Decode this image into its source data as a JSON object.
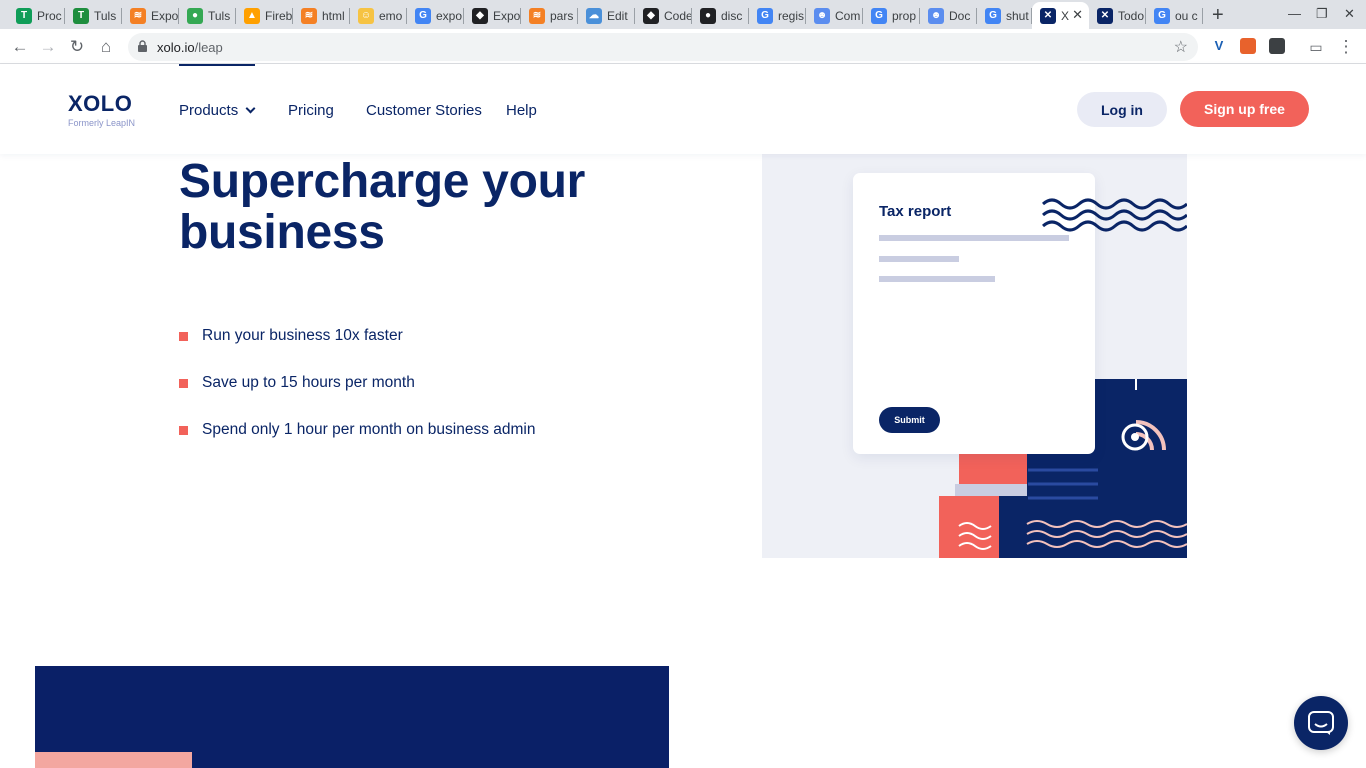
{
  "browser": {
    "tabs": [
      {
        "label": "Proc",
        "icon": "sheets-icon",
        "color": "#0f9d58",
        "glyph": "T"
      },
      {
        "label": "Tuls",
        "icon": "tuls-icon",
        "color": "#1e8e3e",
        "glyph": "T"
      },
      {
        "label": "Expo",
        "icon": "stackoverflow-icon",
        "color": "#f48024",
        "glyph": "≋"
      },
      {
        "label": "Tuls",
        "icon": "leaf-icon",
        "color": "#34a853",
        "glyph": "●"
      },
      {
        "label": "Fireb",
        "icon": "firebase-icon",
        "color": "#ffa000",
        "glyph": "▲"
      },
      {
        "label": "html",
        "icon": "stackoverflow-icon",
        "color": "#f48024",
        "glyph": "≋"
      },
      {
        "label": "emo",
        "icon": "emoji-icon",
        "color": "#f6c343",
        "glyph": "☺"
      },
      {
        "label": "expo",
        "icon": "google-icon",
        "color": "#4285f4",
        "glyph": "G"
      },
      {
        "label": "Expo",
        "icon": "expo-icon",
        "color": "#202124",
        "glyph": "◆"
      },
      {
        "label": "pars",
        "icon": "stackoverflow-icon",
        "color": "#f48024",
        "glyph": "≋"
      },
      {
        "label": "Edit",
        "icon": "cloud-icon",
        "color": "#4a90d9",
        "glyph": "☁"
      },
      {
        "label": "Code",
        "icon": "codepen-icon",
        "color": "#202124",
        "glyph": "◆"
      },
      {
        "label": "disc",
        "icon": "github-icon",
        "color": "#202124",
        "glyph": "●"
      },
      {
        "label": "regis",
        "icon": "google-icon",
        "color": "#4285f4",
        "glyph": "G"
      },
      {
        "label": "Com",
        "icon": "people-icon",
        "color": "#5b8def",
        "glyph": "☻"
      },
      {
        "label": "prop",
        "icon": "google-icon",
        "color": "#4285f4",
        "glyph": "G"
      },
      {
        "label": "Doc",
        "icon": "people-icon",
        "color": "#5b8def",
        "glyph": "☻"
      },
      {
        "label": "shut",
        "icon": "google-icon",
        "color": "#4285f4",
        "glyph": "G"
      },
      {
        "label": "X",
        "icon": "xolo-icon",
        "color": "#0a2566",
        "glyph": "✕"
      },
      {
        "label": "Todo",
        "icon": "xolo-icon",
        "color": "#0a2566",
        "glyph": "✕"
      },
      {
        "label": "ou c",
        "icon": "google-icon",
        "color": "#4285f4",
        "glyph": "G"
      }
    ],
    "url_host": "xolo.io",
    "url_path": "/leap"
  },
  "header": {
    "logo_text": "XOLO",
    "logo_sub": "Formerly LeapIN",
    "nav": {
      "products": "Products",
      "pricing": "Pricing",
      "stories": "Customer Stories",
      "help": "Help"
    },
    "login": "Log in",
    "signup": "Sign up free"
  },
  "hero": {
    "title": "Supercharge your business",
    "bullets": [
      "Run your business 10x faster",
      "Save up to 15 hours per month",
      "Spend only 1 hour per month on business admin"
    ]
  },
  "illustration": {
    "card_title": "Tax report",
    "submit_label": "Submit"
  },
  "colors": {
    "navy": "#0a2566",
    "coral": "#f2625a",
    "pink": "#f3a7a0"
  }
}
